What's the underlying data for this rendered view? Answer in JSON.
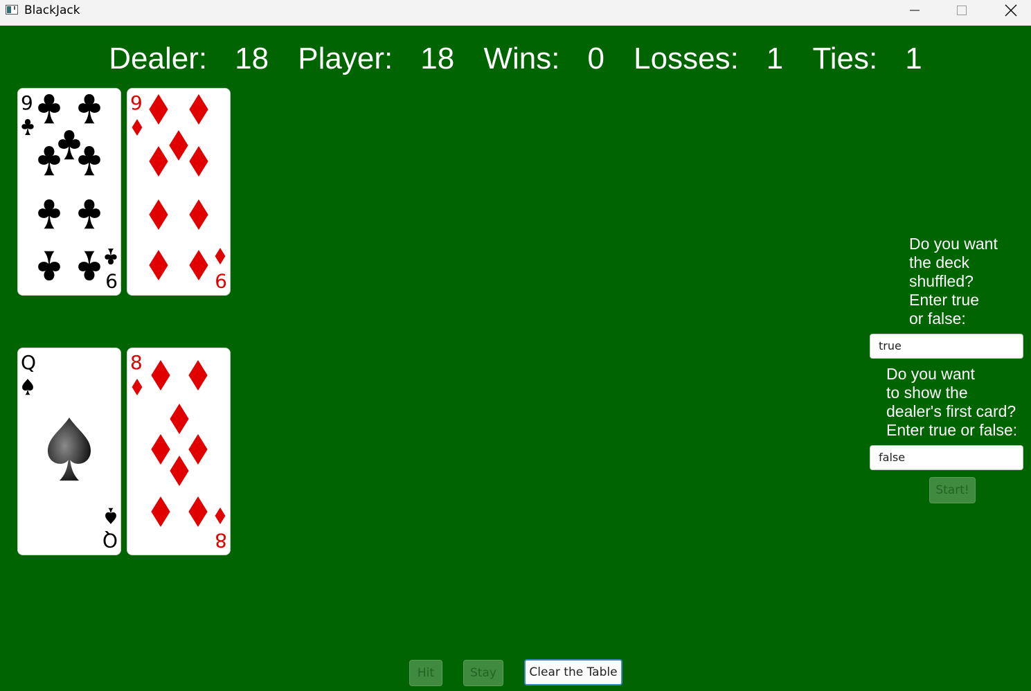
{
  "window": {
    "title": "BlackJack",
    "icons": [
      "app-icon",
      "minimize-icon",
      "maximize-icon",
      "close-icon"
    ]
  },
  "scoreboard": {
    "dealer_label": "Dealer:",
    "dealer_value": "18",
    "player_label": "Player:",
    "player_value": "18",
    "wins_label": "Wins:",
    "wins_value": "0",
    "losses_label": "Losses:",
    "losses_value": "1",
    "ties_label": "Ties:",
    "ties_value": "1"
  },
  "dealer_hand": [
    {
      "rank": "9",
      "suit": "clubs",
      "suit_icon": "club-icon",
      "color": "#000000"
    },
    {
      "rank": "9",
      "suit": "diamonds",
      "suit_icon": "diamond-icon",
      "color": "#e00000"
    }
  ],
  "player_hand": [
    {
      "rank": "Q",
      "suit": "spades",
      "suit_icon": "spade-icon",
      "color": "#000000"
    },
    {
      "rank": "8",
      "suit": "diamonds",
      "suit_icon": "diamond-icon",
      "color": "#e00000"
    }
  ],
  "settings": {
    "shuffle_prompt": "Do you want\nthe deck\nshuffled?\nEnter true\nor false:",
    "shuffle_value": "true",
    "show_dealer_prompt": "Do you want\nto show the\ndealer's first card?\nEnter true or false:",
    "show_dealer_value": "false",
    "start_label": "Start!"
  },
  "actions": {
    "hit_label": "Hit",
    "stay_label": "Stay",
    "clear_label": "Clear the Table"
  },
  "colors": {
    "table_green": "#006400",
    "disabled_button": "#3f8a3f",
    "focus_border": "#3d87c7"
  }
}
